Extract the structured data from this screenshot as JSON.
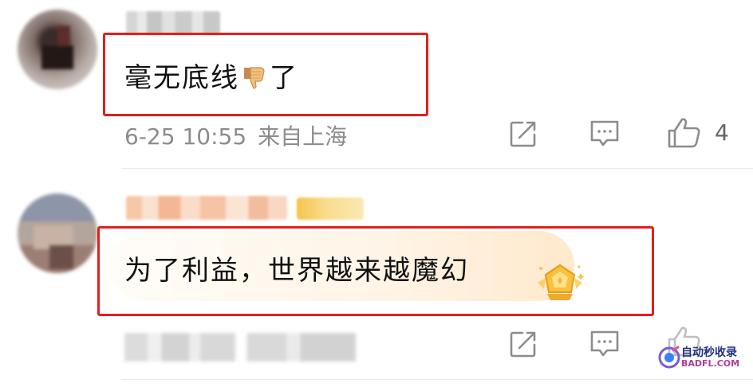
{
  "comments": [
    {
      "username": "",
      "text_before_emoji": "毫无底线",
      "emoji": "thumbs-down-emoji",
      "text_after_emoji": "了",
      "timestamp": "6-25 10:55",
      "location": "来自上海",
      "like_count": "4",
      "highlight_color": "#e0201e"
    },
    {
      "username": "",
      "text": "为了利益，世界越来越魔幻",
      "timestamp": "",
      "location": "",
      "badge": "gold-medal-icon",
      "highlight_color": "#e0201e"
    }
  ],
  "actions": {
    "share_icon": "share-icon",
    "reply_icon": "comment-icon",
    "like_icon": "like-icon"
  },
  "watermark": {
    "line1": "自动秒收录",
    "line2": "BADFL.COM"
  }
}
